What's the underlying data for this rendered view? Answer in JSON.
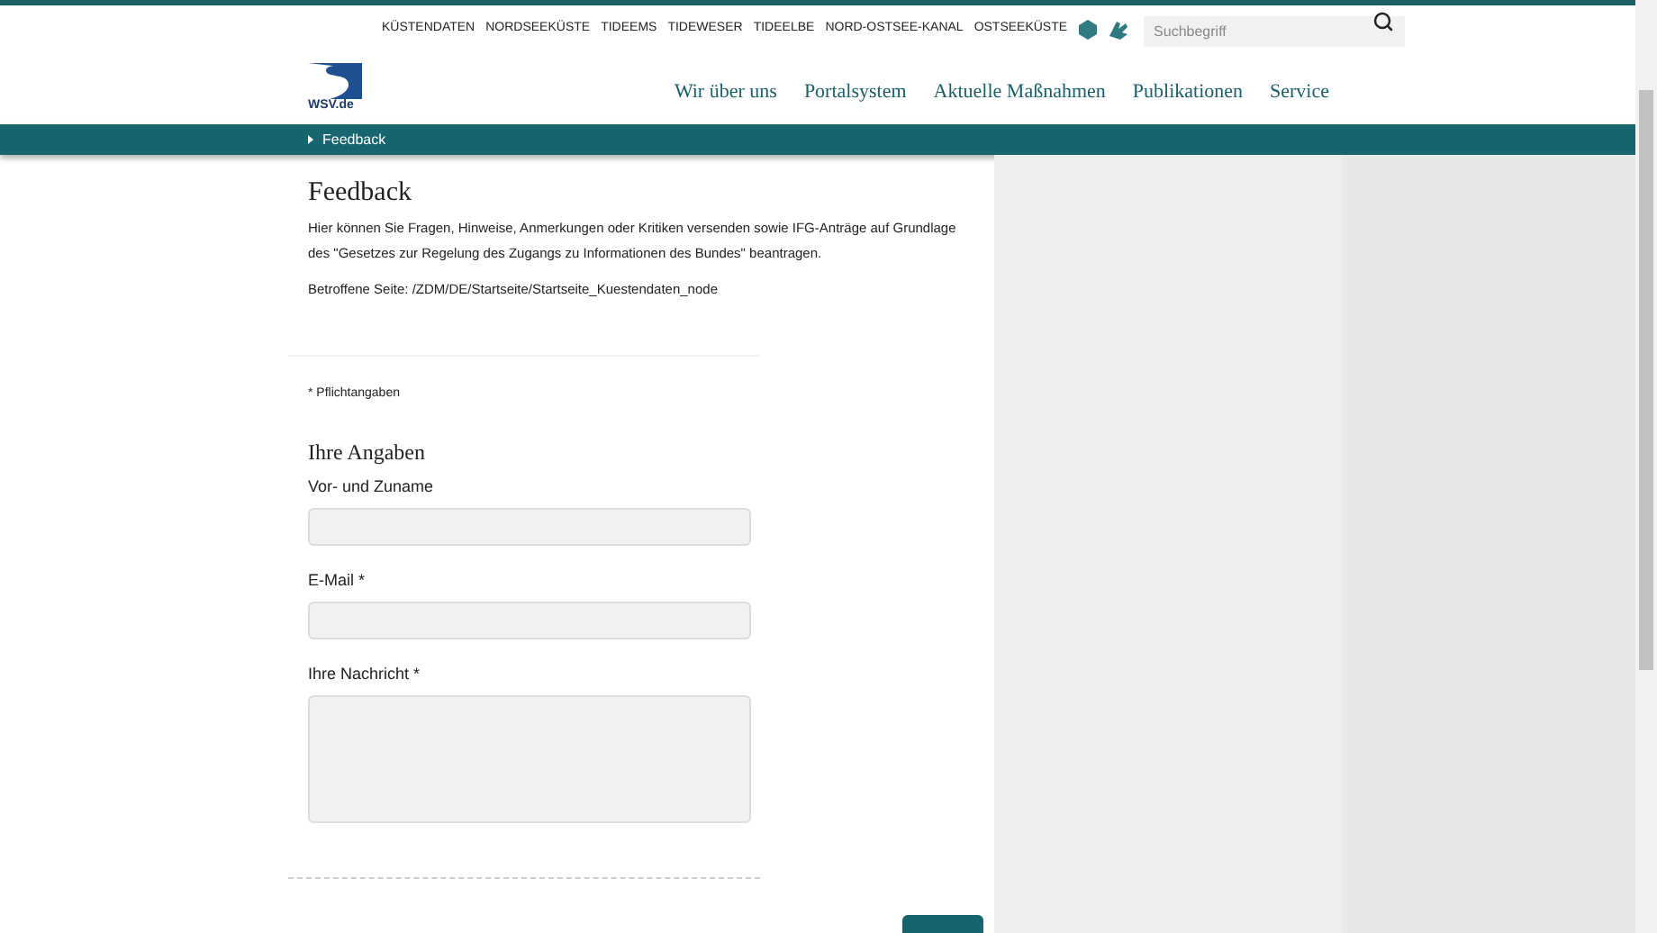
{
  "top_links": [
    "KÜSTENDATEN",
    "NORDSEEKÜSTE",
    "TIDEEMS",
    "TIDEWESER",
    "TIDEELBE",
    "NORD-OSTSEE-KANAL",
    "OSTSEEKÜSTE"
  ],
  "search": {
    "placeholder": "Suchbegriff"
  },
  "logo": {
    "text": "WSV.de"
  },
  "nav": [
    "Wir über uns",
    "Portalsystem",
    "Aktuelle Maßnahmen",
    "Publikationen",
    "Service"
  ],
  "breadcrumb": [
    "Feedback"
  ],
  "page": {
    "title": "Feedback",
    "intro": "Hier können Sie Fragen, Hinweise, Anmerkungen oder Kritiken versenden sowie IFG-Anträge auf Grundlage des \"Gesetzes zur Regelung des Zugangs zu Informationen des Bundes\" beantragen.",
    "affected_page": "Betroffene Seite: /ZDM/DE/Startseite/Startseite_Kuestendaten_node",
    "required_note": "* Pflichtangaben"
  },
  "form": {
    "title": "Ihre Angaben",
    "fields": [
      {
        "label": "Vor- und Zuname",
        "kind": "input"
      },
      {
        "label": "E-Mail *",
        "kind": "input"
      },
      {
        "label": "Ihre Nachricht *",
        "kind": "textarea"
      }
    ]
  }
}
